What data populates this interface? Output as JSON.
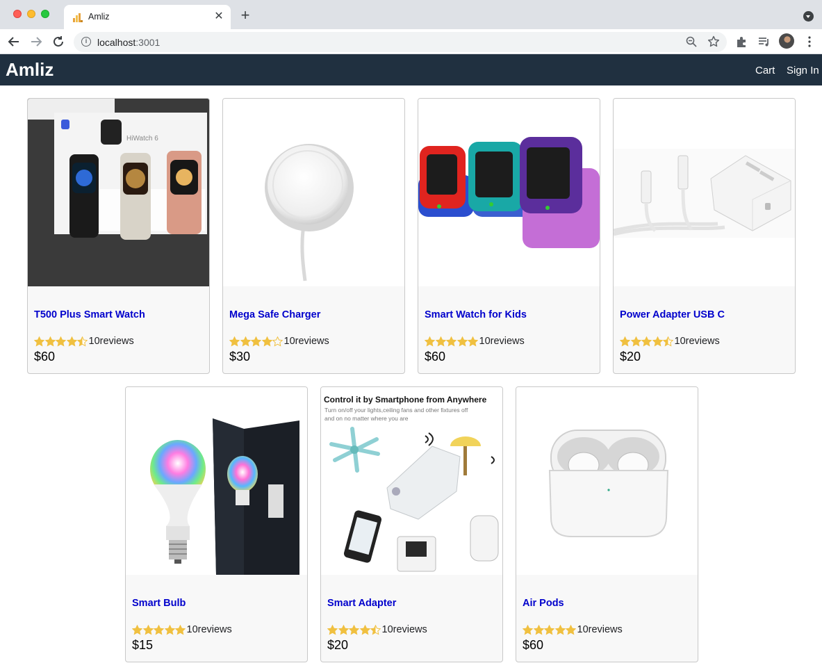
{
  "browser": {
    "tab_title": "Amliz",
    "url_host": "localhost",
    "url_port": ":3001"
  },
  "header": {
    "brand": "Amliz",
    "cart_label": "Cart",
    "signin_label": "Sign In"
  },
  "products": [
    {
      "name": "T500 Plus Smart Watch",
      "rating": 4.5,
      "reviews": "10reviews",
      "price": "$60"
    },
    {
      "name": "Mega Safe Charger",
      "rating": 4,
      "reviews": "10reviews",
      "price": "$30"
    },
    {
      "name": "Smart Watch for Kids",
      "rating": 5,
      "reviews": "10reviews",
      "price": "$60"
    },
    {
      "name": "Power Adapter USB C",
      "rating": 4.5,
      "reviews": "10reviews",
      "price": "$20"
    },
    {
      "name": "Smart Bulb",
      "rating": 5,
      "reviews": "10reviews",
      "price": "$15"
    },
    {
      "name": "Smart Adapter",
      "rating": 4.5,
      "reviews": "10reviews",
      "price": "$20"
    },
    {
      "name": "Air Pods",
      "rating": 5,
      "reviews": "10reviews",
      "price": "$60"
    }
  ],
  "adapter_image_text": {
    "headline": "Control it by Smartphone from Anywhere",
    "subline1": "Turn on/off your lights,ceiling fans and other fixtures off",
    "subline2": "and on no matter where you are"
  },
  "watch_box_text": "HiWatch 6",
  "colors": {
    "header_bg": "#203040",
    "link": "#0000cc",
    "star": "#f0c040"
  }
}
